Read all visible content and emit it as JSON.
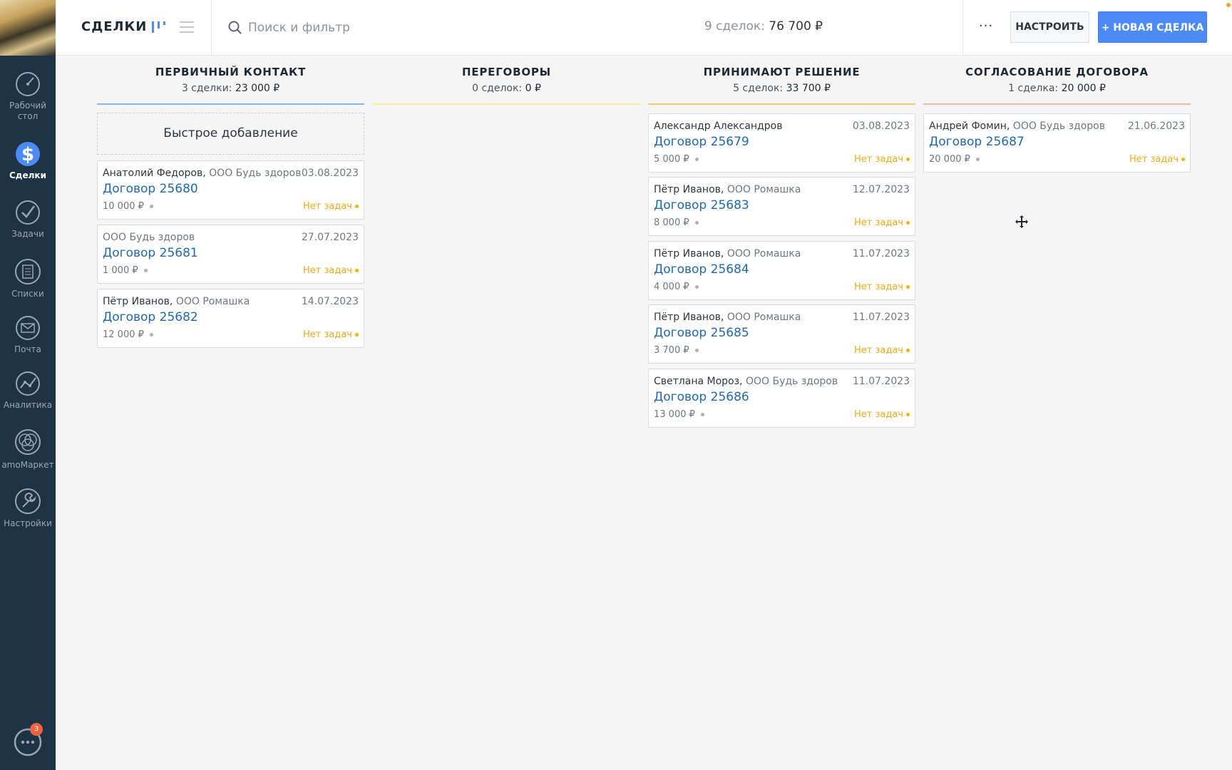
{
  "sidebar": {
    "items": [
      {
        "label": "Рабочий стол",
        "icon": "dashboard-icon"
      },
      {
        "label": "Сделки",
        "icon": "deals-icon",
        "active": true
      },
      {
        "label": "Задачи",
        "icon": "tasks-icon"
      },
      {
        "label": "Списки",
        "icon": "lists-icon"
      },
      {
        "label": "Почта",
        "icon": "mail-icon"
      },
      {
        "label": "Аналитика",
        "icon": "analytics-icon"
      },
      {
        "label": "amoМаркет",
        "icon": "market-icon"
      },
      {
        "label": "Настройки",
        "icon": "settings-icon"
      }
    ],
    "chat_badge": "3"
  },
  "header": {
    "title": "СДЕЛКИ",
    "search_placeholder": "Поиск и фильтр",
    "summary_count": "9 сделок:",
    "summary_amount": "76 700 ₽",
    "more_label": "···",
    "setup_label": "НАСТРОИТЬ",
    "new_deal_label": "+ НОВАЯ СДЕЛКА"
  },
  "colors": {
    "accent": "#4c8bf5",
    "stage_1": "#8ab4f8",
    "stage_2": "#f5f08a",
    "stage_3": "#f7c86a",
    "stage_4": "#f5b8a8"
  },
  "quick_add_label": "Быстрое добавление",
  "columns": [
    {
      "title": "ПЕРВИЧНЫЙ КОНТАКТ",
      "count": "3 сделки:",
      "amount": "23 000 ₽",
      "cards": [
        {
          "contact": "Анатолий Федоров,",
          "company": "ООО Будь здоров",
          "date": "03.08.2023",
          "deal": "Договор 25680",
          "amount": "10 000 ₽",
          "tasks": "Нет задач"
        },
        {
          "contact": "",
          "company": "ООО Будь здоров",
          "date": "27.07.2023",
          "deal": "Договор 25681",
          "amount": "1 000 ₽",
          "tasks": "Нет задач"
        },
        {
          "contact": "Пётр Иванов,",
          "company": "ООО Ромашка",
          "date": "14.07.2023",
          "deal": "Договор 25682",
          "amount": "12 000 ₽",
          "tasks": "Нет задач"
        }
      ]
    },
    {
      "title": "ПЕРЕГОВОРЫ",
      "count": "0 сделок:",
      "amount": "0 ₽",
      "cards": []
    },
    {
      "title": "ПРИНИМАЮТ РЕШЕНИЕ",
      "count": "5 сделок:",
      "amount": "33 700 ₽",
      "cards": [
        {
          "contact": "Александр Александров",
          "company": "",
          "date": "03.08.2023",
          "deal": "Договор 25679",
          "amount": "5 000 ₽",
          "tasks": "Нет задач"
        },
        {
          "contact": "Пётр Иванов,",
          "company": "ООО Ромашка",
          "date": "12.07.2023",
          "deal": "Договор 25683",
          "amount": "8 000 ₽",
          "tasks": "Нет задач"
        },
        {
          "contact": "Пётр Иванов,",
          "company": "ООО Ромашка",
          "date": "11.07.2023",
          "deal": "Договор 25684",
          "amount": "4 000 ₽",
          "tasks": "Нет задач"
        },
        {
          "contact": "Пётр Иванов,",
          "company": "ООО Ромашка",
          "date": "11.07.2023",
          "deal": "Договор 25685",
          "amount": "3 700 ₽",
          "tasks": "Нет задач"
        },
        {
          "contact": "Светлана Мороз,",
          "company": "ООО Будь здоров",
          "date": "11.07.2023",
          "deal": "Договор 25686",
          "amount": "13 000 ₽",
          "tasks": "Нет задач"
        }
      ]
    },
    {
      "title": "СОГЛАСОВАНИЕ ДОГОВОРА",
      "count": "1 сделка:",
      "amount": "20 000 ₽",
      "cards": [
        {
          "contact": "Андрей Фомин,",
          "company": "ООО Будь здоров",
          "date": "21.06.2023",
          "deal": "Договор 25687",
          "amount": "20 000 ₽",
          "tasks": "Нет задач"
        }
      ]
    }
  ]
}
